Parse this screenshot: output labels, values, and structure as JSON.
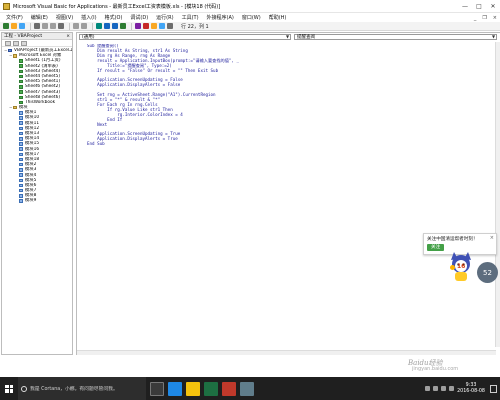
{
  "window": {
    "title": "Microsoft Visual Basic for Applications - 最新员工Excel工资表模板.xls - [模块18 (代码)]",
    "minimize": "—",
    "maximize": "□",
    "close": "✕"
  },
  "menu": {
    "items": [
      "文件(F)",
      "编辑(E)",
      "视图(V)",
      "插入(I)",
      "格式(O)",
      "调试(D)",
      "运行(R)",
      "工具(T)",
      "外接程序(A)",
      "窗口(W)",
      "帮助(H)"
    ],
    "mdi_min": "_",
    "mdi_restore": "❐",
    "mdi_close": "×"
  },
  "toolbar": {
    "cursor_position": "行 22，列 1"
  },
  "project": {
    "header": "工程 - VBAProject",
    "close": "×",
    "tree": [
      {
        "label": "VBAProject (最新员工Excel工资表模板.xls)",
        "level": 1,
        "icon": "proj",
        "toggle": "−"
      },
      {
        "label": "Microsoft Excel 对象",
        "level": 2,
        "icon": "fold",
        "toggle": "−"
      },
      {
        "label": "Sheet1 (1月工资)",
        "level": 3,
        "icon": "sheet",
        "toggle": ""
      },
      {
        "label": "Sheet2 (清单表)",
        "level": 3,
        "icon": "sheet",
        "toggle": ""
      },
      {
        "label": "Sheet3 (Sheet4)",
        "level": 3,
        "icon": "sheet",
        "toggle": ""
      },
      {
        "label": "Sheet4 (Sheet5)",
        "level": 3,
        "icon": "sheet",
        "toggle": ""
      },
      {
        "label": "Sheet5 (Sheet1)",
        "level": 3,
        "icon": "sheet",
        "toggle": ""
      },
      {
        "label": "Sheet6 (Sheet2)",
        "level": 3,
        "icon": "sheet",
        "toggle": ""
      },
      {
        "label": "Sheet7 (Sheet3)",
        "level": 3,
        "icon": "sheet",
        "toggle": ""
      },
      {
        "label": "Sheet8 (Sheet6)",
        "level": 3,
        "icon": "sheet",
        "toggle": ""
      },
      {
        "label": "ThisWorkbook",
        "level": 3,
        "icon": "sheet",
        "toggle": ""
      },
      {
        "label": "模块",
        "level": 2,
        "icon": "fold",
        "toggle": "−"
      },
      {
        "label": "模块1",
        "level": 3,
        "icon": "mod",
        "toggle": ""
      },
      {
        "label": "模块10",
        "level": 3,
        "icon": "mod",
        "toggle": ""
      },
      {
        "label": "模块11",
        "level": 3,
        "icon": "mod",
        "toggle": ""
      },
      {
        "label": "模块12",
        "level": 3,
        "icon": "mod",
        "toggle": ""
      },
      {
        "label": "模块13",
        "level": 3,
        "icon": "mod",
        "toggle": ""
      },
      {
        "label": "模块14",
        "level": 3,
        "icon": "mod",
        "toggle": ""
      },
      {
        "label": "模块15",
        "level": 3,
        "icon": "mod",
        "toggle": ""
      },
      {
        "label": "模块16",
        "level": 3,
        "icon": "mod",
        "toggle": ""
      },
      {
        "label": "模块17",
        "level": 3,
        "icon": "mod",
        "toggle": ""
      },
      {
        "label": "模块18",
        "level": 3,
        "icon": "mod",
        "toggle": ""
      },
      {
        "label": "模块2",
        "level": 3,
        "icon": "mod",
        "toggle": ""
      },
      {
        "label": "模块3",
        "level": 3,
        "icon": "mod",
        "toggle": ""
      },
      {
        "label": "模块4",
        "level": 3,
        "icon": "mod",
        "toggle": ""
      },
      {
        "label": "模块5",
        "level": 3,
        "icon": "mod",
        "toggle": ""
      },
      {
        "label": "模块6",
        "level": 3,
        "icon": "mod",
        "toggle": ""
      },
      {
        "label": "模块7",
        "level": 3,
        "icon": "mod",
        "toggle": ""
      },
      {
        "label": "模块8",
        "level": 3,
        "icon": "mod",
        "toggle": ""
      },
      {
        "label": "模块9",
        "level": 3,
        "icon": "mod",
        "toggle": ""
      }
    ]
  },
  "code_window": {
    "object_combo": "(通用)",
    "proc_combo": "提醒查阅",
    "code": "Sub 提醒查阅()\n    Dim result As String, str1 As String\n    Dim rg As Range, rng As Range\n    result = Application.InputBox(prompt:=\"请输入要查找的值\", _\n        Title:=\"提醒查阅\", Type:=2)\n    If result = \"False\" Or result = \"\" Then Exit Sub\n\n    Application.ScreenUpdating = False\n    Application.DisplayAlerts = False\n\n    Set rng = ActiveSheet.Range(\"A1\").CurrentRegion\n    str1 = \"*\" & result & \"*\"\n    For Each rg In rng.Cells\n        If rg.Value Like str1 Then\n            rg.Interior.ColorIndex = 4\n        End If\n    Next\n\n    Application.ScreenUpdating = True\n    Application.DisplayAlerts = True\nEnd Sub"
  },
  "popup": {
    "message": "关注中国清运帮者时刻！",
    "follow_label": "关注",
    "close": "×",
    "likes": "16",
    "bubble": "52"
  },
  "watermark": {
    "brand": "Baidu经验",
    "url": "jingyan.baidu.com"
  },
  "taskbar": {
    "search_text": "我是 Cortana，小娜。有问题尽管问我。",
    "time": "9:33",
    "date": "2016-08-08"
  }
}
